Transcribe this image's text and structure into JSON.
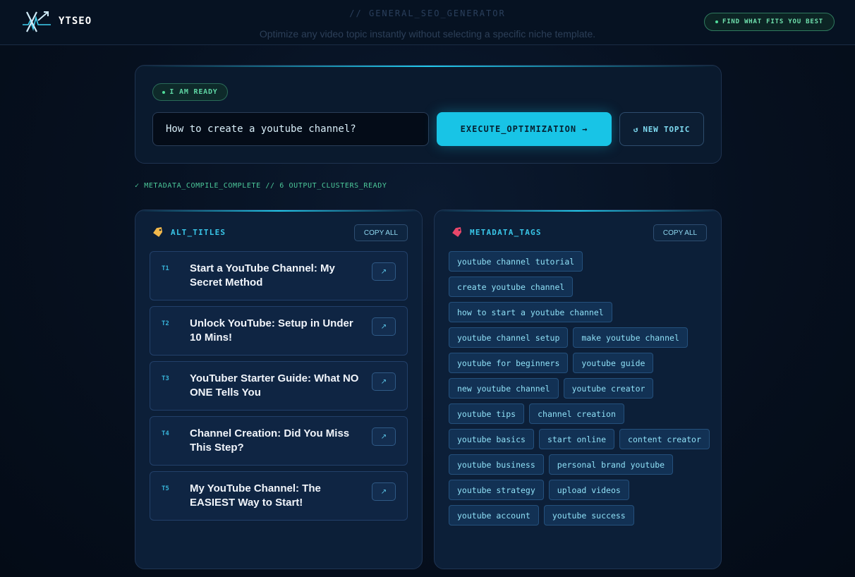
{
  "header": {
    "brand": "YTSEO",
    "title": "// GENERAL_SEO_GENERATOR",
    "subtitle": "Optimize any video topic instantly without selecting a specific niche template.",
    "fit_button": "FIND WHAT FITS YOU BEST"
  },
  "input_card": {
    "badge": "I AM READY",
    "topic_value": "How to create a youtube channel?",
    "execute_label": "EXECUTE_OPTIMIZATION",
    "execute_arrow": "→",
    "new_topic_icon": "↺",
    "new_topic_label": "NEW TOPIC"
  },
  "status": "✓ METADATA_COMPILE_COMPLETE // 6 OUTPUT_CLUSTERS_READY",
  "titles_panel": {
    "title": "ALT_TITLES",
    "icon": "tag-icon",
    "copy_label": "COPY ALL",
    "items": [
      {
        "tag": "T1",
        "text": "Start a YouTube Channel: My Secret Method"
      },
      {
        "tag": "T2",
        "text": "Unlock YouTube: Setup in Under 10 Mins!"
      },
      {
        "tag": "T3",
        "text": "YouTuber Starter Guide: What NO ONE Tells You"
      },
      {
        "tag": "T4",
        "text": "Channel Creation: Did You Miss This Step?"
      },
      {
        "tag": "T5",
        "text": "My YouTube Channel: The EASIEST Way to Start!"
      }
    ]
  },
  "tags_panel": {
    "title": "METADATA_TAGS",
    "icon": "label-icon",
    "copy_label": "COPY ALL",
    "tags": [
      "youtube channel tutorial",
      "create youtube channel",
      "how to start a youtube channel",
      "youtube channel setup",
      "make youtube channel",
      "youtube for beginners",
      "youtube guide",
      "new youtube channel",
      "youtube creator",
      "youtube tips",
      "channel creation",
      "youtube basics",
      "start online",
      "content creator",
      "youtube business",
      "personal brand youtube",
      "youtube strategy",
      "upload videos",
      "youtube account",
      "youtube success"
    ]
  },
  "colors": {
    "background": "#050d1a",
    "accent": "#18c4e6",
    "success": "#4cc99a",
    "panel": "#0c1f38"
  }
}
